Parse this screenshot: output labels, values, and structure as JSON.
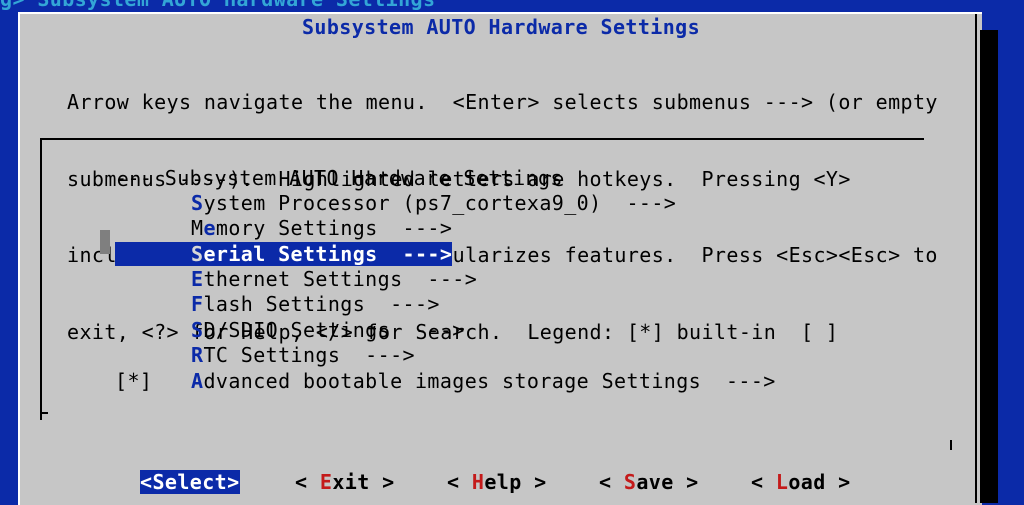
{
  "window": {
    "top_title": "g> Subsystem AUTO Hardware Settings",
    "title": "Subsystem AUTO Hardware Settings"
  },
  "help_text": [
    "Arrow keys navigate the menu.  <Enter> selects submenus ---> (or empty",
    "submenus ----).  Highlighted letters are hotkeys.  Pressing <Y>",
    "includes, <N> excludes, <M> modularizes features.  Press <Esc><Esc> to",
    "exit, <?> for Help, </> for Search.  Legend: [*] built-in  [ ]"
  ],
  "menu": {
    "header": "--- Subsystem AUTO Hardware Settings",
    "items": [
      {
        "hot": "S",
        "rest": "ystem Processor (ps7_cortexa9_0)  --->"
      },
      {
        "pre": "M",
        "hot": "e",
        "rest": "mory Settings  --->"
      },
      {
        "hot": "S",
        "rest": "erial Settings  --->"
      },
      {
        "hot": "E",
        "rest": "thernet Settings  --->"
      },
      {
        "hot": "F",
        "rest": "lash Settings  --->"
      },
      {
        "hot": "S",
        "rest": "D/SDIO Settings  --->"
      },
      {
        "hot": "R",
        "rest": "TC Settings  --->"
      },
      {
        "check": "[*]",
        "hot": "A",
        "rest": "dvanced bootable images storage Settings  --->"
      }
    ]
  },
  "buttons": [
    {
      "pre": "<",
      "hot": "S",
      "rest": "elect>"
    },
    {
      "pre": "< ",
      "hot": "E",
      "rest": "xit >"
    },
    {
      "pre": "< ",
      "hot": "H",
      "rest": "elp >"
    },
    {
      "pre": "< ",
      "hot": "S",
      "rest": "ave >"
    },
    {
      "pre": "< ",
      "hot": "L",
      "rest": "oad >"
    }
  ],
  "colors": {
    "background": "#0b2aa8",
    "dialog": "#c6c6c6",
    "hotkey": "#0b2aa8",
    "button_hotkey": "#c41a1a"
  }
}
